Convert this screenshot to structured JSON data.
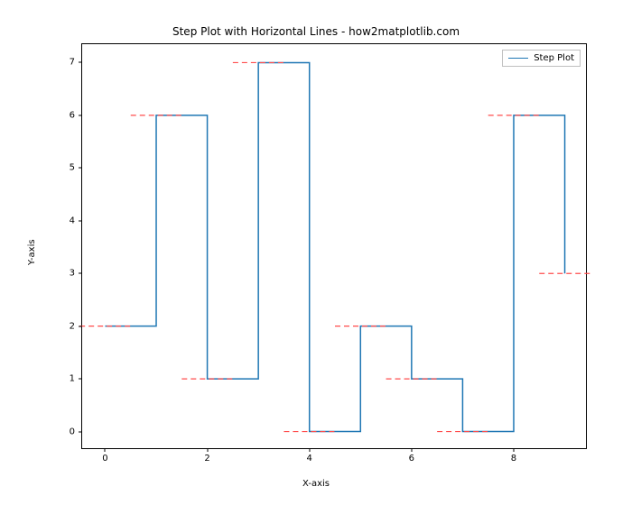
{
  "chart_data": {
    "type": "line",
    "step_mode": "post",
    "x": [
      0,
      1,
      2,
      3,
      4,
      5,
      6,
      7,
      8,
      9
    ],
    "y": [
      2,
      6,
      1,
      7,
      0,
      2,
      1,
      0,
      6,
      3
    ],
    "title": "Step Plot with Horizontal Lines - how2matplotlib.com",
    "xlabel": "X-axis",
    "ylabel": "Y-axis",
    "xlim": [
      -0.45,
      9.45
    ],
    "ylim": [
      -0.35,
      7.35
    ],
    "xticks": [
      0,
      2,
      4,
      6,
      8
    ],
    "yticks": [
      0,
      1,
      2,
      3,
      4,
      5,
      6,
      7
    ],
    "series": [
      {
        "name": "Step Plot",
        "color": "#1f77b4",
        "style": "step"
      }
    ],
    "hlines": {
      "color": "#ff4c4c",
      "style": "dashed",
      "half_width": 0.5,
      "levels": [
        2,
        6,
        1,
        7,
        0,
        2,
        1,
        0,
        6,
        3
      ],
      "centers": [
        0,
        1,
        2,
        3,
        4,
        5,
        6,
        7,
        8,
        9
      ]
    },
    "legend_label": "Step Plot"
  }
}
